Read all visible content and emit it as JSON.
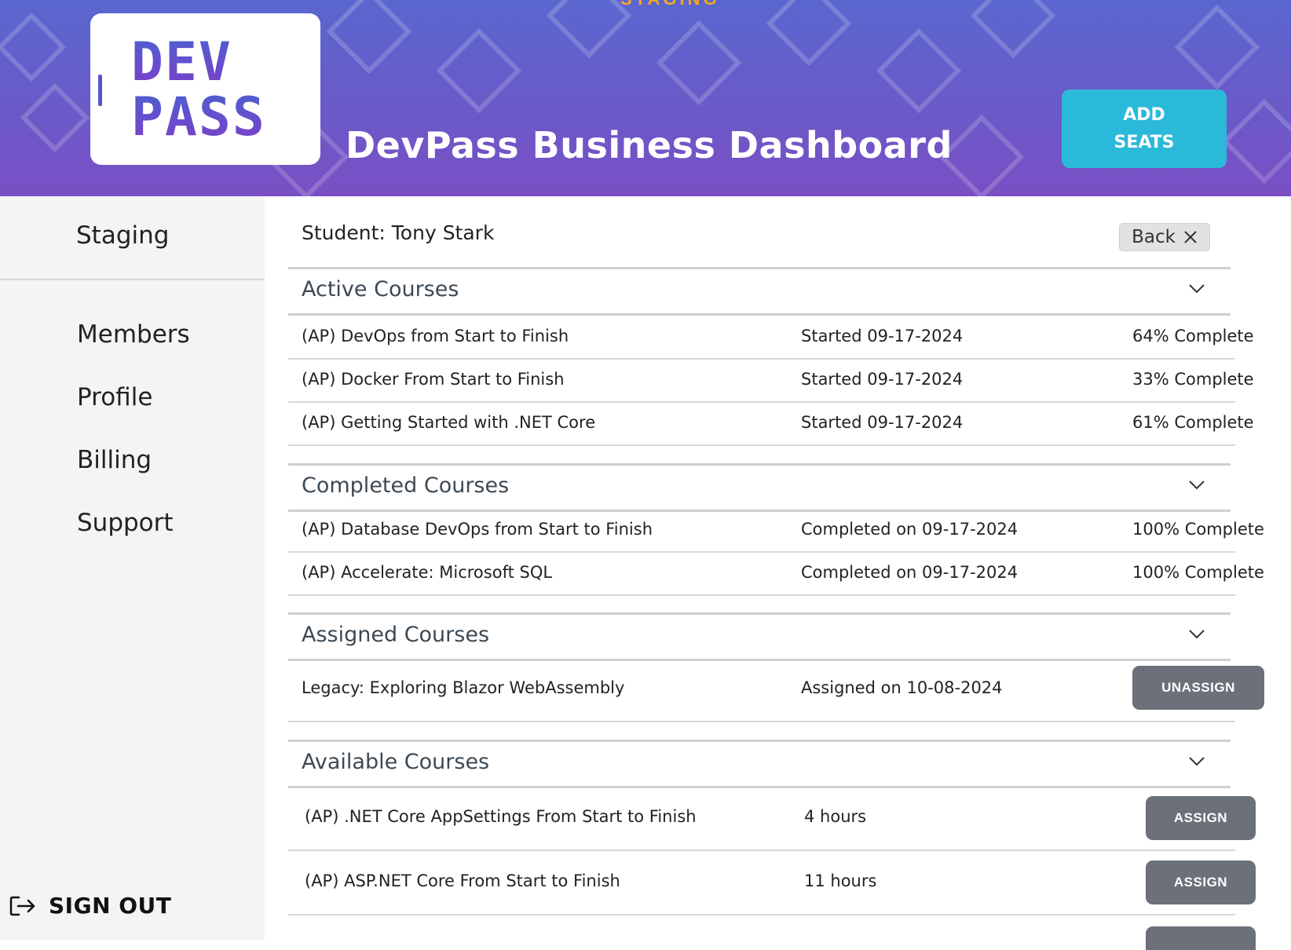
{
  "header": {
    "environment": "STAGING",
    "logo_line1": "DEV",
    "logo_line2": "PASS",
    "title": "DevPass Business Dashboard",
    "add_seats_label": "ADD\nSEATS"
  },
  "sidebar": {
    "environment": "Staging",
    "items": [
      {
        "label": "Members"
      },
      {
        "label": "Profile"
      },
      {
        "label": "Billing"
      },
      {
        "label": "Support"
      }
    ],
    "signout_label": "SIGN OUT"
  },
  "main": {
    "student_title": "Student: Tony Stark",
    "back_label": "Back",
    "sections": {
      "active": {
        "title": "Active Courses",
        "rows": [
          {
            "name": "(AP) DevOps from Start to Finish",
            "status": "Started 09-17-2024",
            "progress": "64% Complete"
          },
          {
            "name": "(AP) Docker From Start to Finish",
            "status": "Started 09-17-2024",
            "progress": "33% Complete"
          },
          {
            "name": "(AP) Getting Started with .NET Core",
            "status": "Started 09-17-2024",
            "progress": "61% Complete"
          }
        ]
      },
      "completed": {
        "title": "Completed Courses",
        "rows": [
          {
            "name": "(AP) Database DevOps from Start to Finish",
            "status": "Completed on 09-17-2024",
            "progress": "100% Complete"
          },
          {
            "name": "(AP) Accelerate: Microsoft SQL",
            "status": "Completed on 09-17-2024",
            "progress": "100% Complete"
          }
        ]
      },
      "assigned": {
        "title": "Assigned Courses",
        "rows": [
          {
            "name": "Legacy: Exploring Blazor WebAssembly",
            "status": "Assigned on 10-08-2024",
            "action": "UNASSIGN"
          }
        ]
      },
      "available": {
        "title": "Available Courses",
        "rows": [
          {
            "name": "(AP) .NET Core AppSettings From Start to Finish",
            "duration": "4 hours",
            "action": "ASSIGN"
          },
          {
            "name": "(AP) ASP.NET Core From Start to Finish",
            "duration": "11 hours",
            "action": "ASSIGN"
          }
        ]
      }
    }
  },
  "colors": {
    "header_gradient_top": "#5a67cf",
    "header_gradient_bottom": "#7a4fc4",
    "add_seats_bg": "#2ab9d9",
    "action_button_bg": "#6b7079",
    "environment_accent": "#f5a623"
  }
}
